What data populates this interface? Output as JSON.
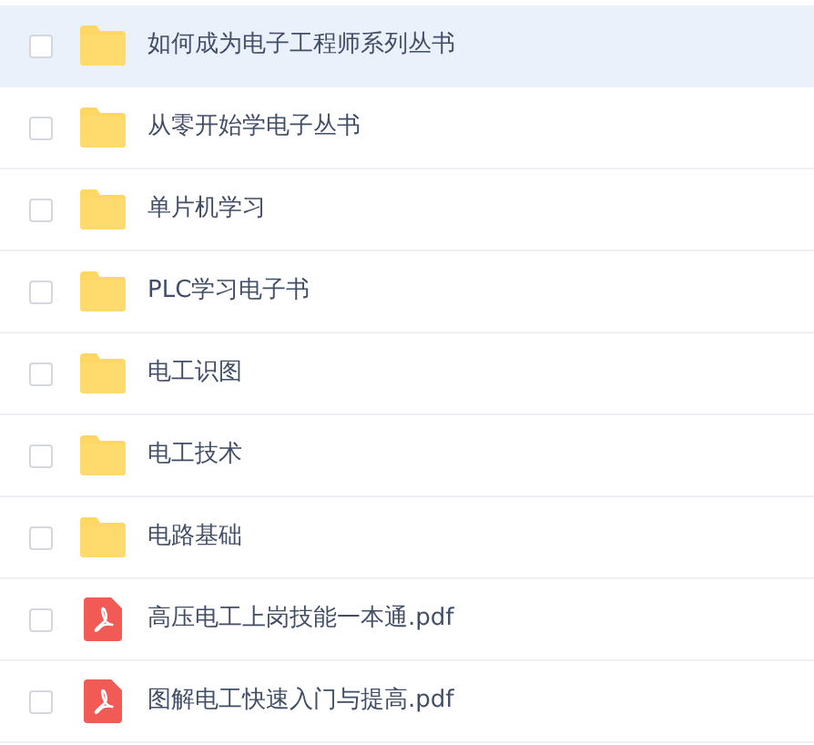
{
  "files": [
    {
      "name": "如何成为电子工程师系列丛书",
      "kind": "folder",
      "checked": false,
      "highlighted": true
    },
    {
      "name": "从零开始学电子丛书",
      "kind": "folder",
      "checked": false,
      "highlighted": false
    },
    {
      "name": "单片机学习",
      "kind": "folder",
      "checked": false,
      "highlighted": false
    },
    {
      "name": "PLC学习电子书",
      "kind": "folder",
      "checked": false,
      "highlighted": false
    },
    {
      "name": "电工识图",
      "kind": "folder",
      "checked": false,
      "highlighted": false
    },
    {
      "name": "电工技术",
      "kind": "folder",
      "checked": false,
      "highlighted": false
    },
    {
      "name": "电路基础",
      "kind": "folder",
      "checked": false,
      "highlighted": false
    },
    {
      "name": "高压电工上岗技能一本通.pdf",
      "kind": "pdf",
      "checked": false,
      "highlighted": false
    },
    {
      "name": "图解电工快速入门与提高.pdf",
      "kind": "pdf",
      "checked": false,
      "highlighted": false
    }
  ]
}
